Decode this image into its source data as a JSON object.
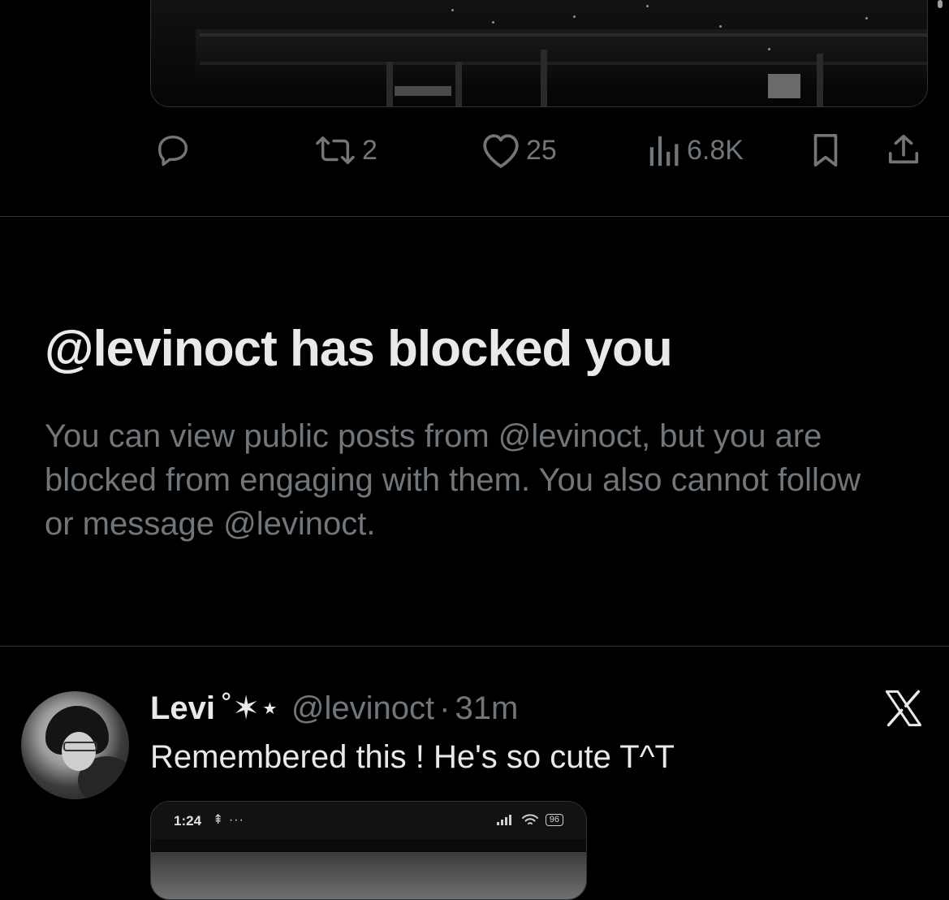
{
  "previous_tweet": {
    "actions": {
      "reply": {
        "icon": "reply-icon"
      },
      "retweet": {
        "icon": "retweet-icon",
        "count": "2"
      },
      "like": {
        "icon": "heart-icon",
        "count": "25"
      },
      "views": {
        "icon": "views-icon",
        "count": "6.8K"
      },
      "bookmark": {
        "icon": "bookmark-icon"
      },
      "share": {
        "icon": "share-icon"
      }
    }
  },
  "blocked_notice": {
    "title": "@levinoct has blocked you",
    "body": "You can view public posts from @levinoct, but you are blocked from engaging with them. You also cannot follow or message @levinoct."
  },
  "next_tweet": {
    "display_name": "Levi",
    "name_decoration": "˚✶⋆",
    "handle": "@levinoct",
    "separator": "·",
    "time": "31m",
    "text": "Remembered this ! He's so cute T^T",
    "media": {
      "status_time": "1:24",
      "status_extra": "⇞ ···",
      "battery": "96"
    }
  },
  "colors": {
    "background": "#000000",
    "primary_text": "#e7e9ea",
    "secondary_text": "#71767b",
    "divider": "#2f3336"
  }
}
